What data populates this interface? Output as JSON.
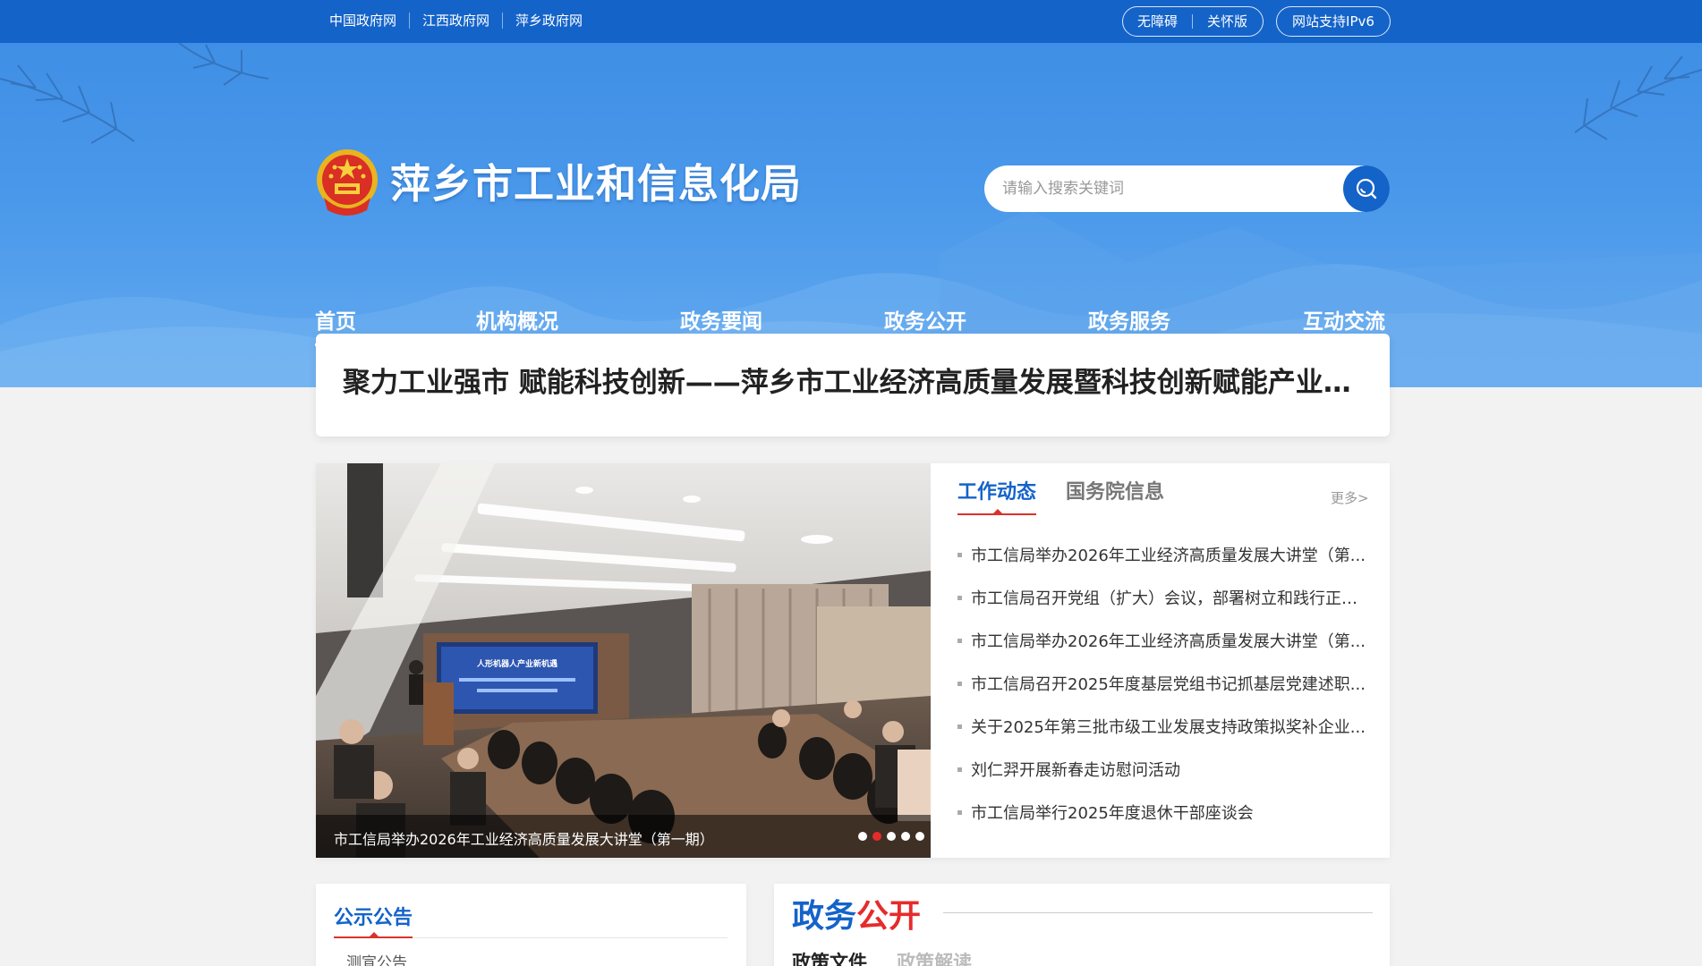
{
  "topbar": {
    "links": [
      "中国政府网",
      "江西政府网",
      "萍乡政府网"
    ],
    "accessibility": "无障碍",
    "elder_mode": "关怀版",
    "ipv6": "网站支持IPv6"
  },
  "header": {
    "site_title": "萍乡市工业和信息化局",
    "search_placeholder": "请输入搜索关键词"
  },
  "nav": [
    "首页",
    "机构概况",
    "政务要闻",
    "政务公开",
    "政务服务",
    "互动交流"
  ],
  "headline": "聚力工业强市 赋能科技创新——萍乡市工业经济高质量发展暨科技创新赋能产业发展推进会",
  "carousel": {
    "caption": "市工信局举办2026年工业经济高质量发展大讲堂（第一期）",
    "screen_text": "人形机器人产业新机遇",
    "active_index": 1,
    "count": 5
  },
  "news": {
    "tabs": [
      "工作动态",
      "国务院信息"
    ],
    "more": "更多>",
    "items": [
      "市工信局举办2026年工业经济高质量发展大讲堂（第...",
      "市工信局召开党组（扩大）会议，部署树立和践行正确...",
      "市工信局举办2026年工业经济高质量发展大讲堂（第...",
      "市工信局召开2025年度基层党组书记抓基层党建述职...",
      "关于2025年第三批市级工业发展支持政策拟奖补企业...",
      "刘仁羿开展新春走访慰问活动",
      "市工信局举行2025年度退休干部座谈会"
    ]
  },
  "notice": {
    "title": "公示公告",
    "sub": "测宣公告"
  },
  "gov_open": {
    "title_part1": "政务",
    "title_part2": "公开",
    "tabs": [
      "政策文件",
      "政策解读"
    ]
  },
  "colors": {
    "primary_blue": "#1463c9",
    "accent_red": "#e62b2b"
  }
}
